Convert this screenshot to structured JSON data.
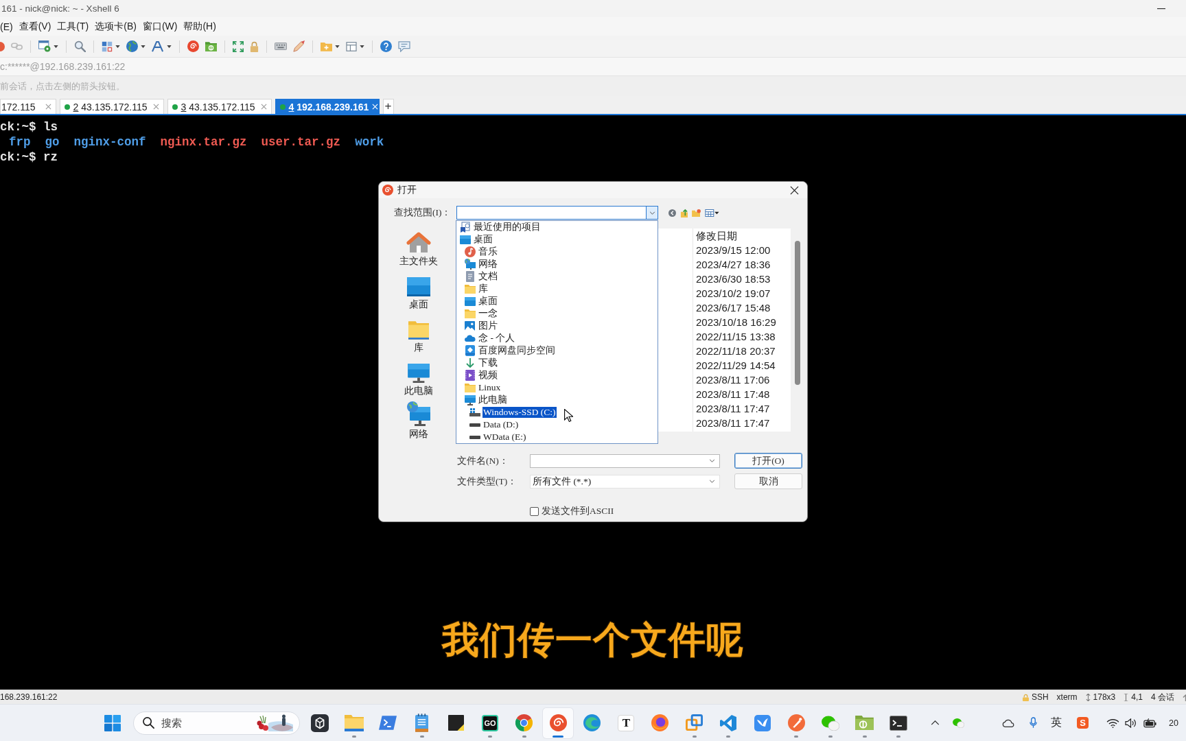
{
  "window": {
    "title": "161 - nick@nick: ~ - Xshell 6"
  },
  "menu_bar": [
    "(E)",
    "查看(V)",
    "工具(T)",
    "选项卡(B)",
    "窗口(W)",
    "帮助(H)"
  ],
  "address_bar": {
    "text": "c:******@192.168.239.161:22"
  },
  "hint_bar": {
    "text": "前会话，点击左侧的箭头按钮。"
  },
  "session_tabs": [
    {
      "host": "172.115",
      "selected": false
    },
    {
      "number": "2",
      "host": "43.135.172.115",
      "color": "#1fa347",
      "selected": false
    },
    {
      "number": "3",
      "host": "43.135.172.115",
      "color": "#1fa347",
      "selected": false
    },
    {
      "number": "4",
      "host": "192.168.239.161",
      "color": "#1fa347",
      "selected": true
    }
  ],
  "new_tab": "+",
  "terminal": {
    "lines": [
      {
        "segments": [
          {
            "kind": "prompt",
            "text": "ck:~$ ls"
          }
        ]
      },
      {
        "segments": [
          {
            "kind": "directory",
            "text": "frp"
          },
          {
            "kind": "directory",
            "text": "go"
          },
          {
            "kind": "directory",
            "text": "nginx-conf"
          },
          {
            "kind": "archive",
            "text": "nginx.tar.gz"
          },
          {
            "kind": "archive",
            "text": "user.tar.gz"
          },
          {
            "kind": "directory",
            "text": "work"
          }
        ]
      },
      {
        "segments": [
          {
            "kind": "prompt",
            "text": "ck:~$ rz"
          }
        ]
      }
    ]
  },
  "dialog": {
    "title": "打开",
    "look_in": {
      "label": "查找范围(I)：",
      "expanded": true,
      "options": [
        {
          "label": "最近使用的项目",
          "selected": false
        },
        {
          "label": "桌面",
          "selected": false,
          "children": [
            {
              "label": "音乐",
              "selected": false
            },
            {
              "label": "网络",
              "selected": false
            },
            {
              "label": "文档",
              "selected": false
            },
            {
              "label": "库",
              "selected": false
            },
            {
              "label": "桌面",
              "selected": false
            },
            {
              "label": "一念",
              "selected": false
            },
            {
              "label": "图片",
              "selected": false
            },
            {
              "label": "念 - 个人",
              "selected": false
            },
            {
              "label": "百度网盘同步空间",
              "selected": false
            },
            {
              "label": "下载",
              "selected": false
            },
            {
              "label": "视频",
              "selected": false
            },
            {
              "label": "Linux",
              "selected": false
            },
            {
              "label": "此电脑",
              "selected": false,
              "children": [
                {
                  "label": "Windows-SSD (C:)",
                  "selected": true
                },
                {
                  "label": "Data (D:)",
                  "selected": false
                },
                {
                  "label": "WData (E:)",
                  "selected": false
                }
              ]
            }
          ]
        }
      ]
    },
    "places": [
      "主文件夹",
      "桌面",
      "库",
      "此电脑",
      "网络"
    ],
    "file_list": {
      "columns": [
        "修改日期"
      ],
      "rows": [
        {
          "modified_date": "2023/9/15 12:00"
        },
        {
          "modified_date": "2023/4/27 18:36"
        },
        {
          "modified_date": "2023/6/30 18:53"
        },
        {
          "modified_date": "2023/10/2 19:07"
        },
        {
          "modified_date": "2023/6/17 15:48"
        },
        {
          "modified_date": "2023/10/18 16:29"
        },
        {
          "modified_date": "2022/11/15 13:38"
        },
        {
          "modified_date": "2022/11/18 20:37"
        },
        {
          "modified_date": "2022/11/29 14:54"
        },
        {
          "modified_date": "2023/8/11 17:06"
        },
        {
          "modified_date": "2023/8/11 17:48"
        },
        {
          "modified_date": "2023/8/11 17:47"
        },
        {
          "modified_date": "2023/8/11 17:47"
        }
      ]
    },
    "file_name": {
      "label": "文件名(N)："
    },
    "file_type": {
      "label": "文件类型(T)：",
      "value": "所有文件 (*.*)"
    },
    "buttons": [
      {
        "label": "打开(O)",
        "default": true
      },
      {
        "label": "取消",
        "default": false
      }
    ],
    "send_ascii": {
      "label": "发送文件到ASCII",
      "checked": false
    }
  },
  "subtitle": "我们传一个文件呢",
  "status_bar": {
    "address": "168.239.161:22",
    "fields": [
      "SSH",
      "xterm",
      "178x3",
      "4,1",
      "4 会话"
    ]
  },
  "taskbar": {
    "search": {
      "placeholder": "搜索"
    },
    "apps": [
      {
        "running": false,
        "active": false
      },
      {
        "running": true,
        "active": false
      },
      {
        "running": false,
        "active": false
      },
      {
        "running": true,
        "active": false
      },
      {
        "running": false,
        "active": false
      },
      {
        "running": true,
        "active": false,
        "text": "GO"
      },
      {
        "running": true,
        "active": false
      },
      {
        "running": true,
        "active": true
      },
      {
        "running": false,
        "active": false
      },
      {
        "running": false,
        "active": false,
        "text": "T"
      },
      {
        "running": false,
        "active": false
      },
      {
        "running": true,
        "active": false
      },
      {
        "running": true,
        "active": false
      },
      {
        "running": false,
        "active": false
      },
      {
        "running": true,
        "active": false
      },
      {
        "running": true,
        "active": false
      },
      {
        "running": true,
        "active": false
      },
      {
        "running": true,
        "active": false
      }
    ],
    "tray": {
      "language": "英",
      "ime": "S",
      "clock": "20"
    }
  }
}
